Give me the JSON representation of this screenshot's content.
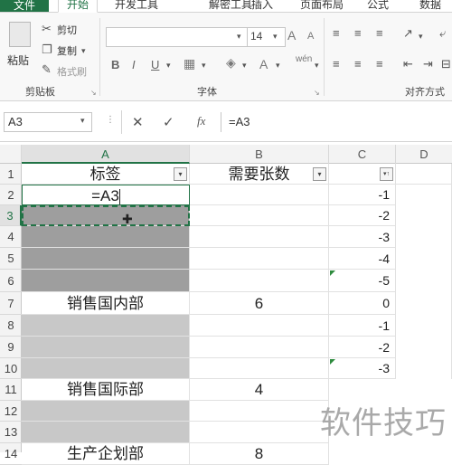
{
  "ribbon_tabs": [
    "文件",
    "开始",
    "开发工具",
    "解密工具",
    "插入",
    "页面布局",
    "公式",
    "数据"
  ],
  "clipboard": {
    "paste": "粘贴",
    "cut": "剪切",
    "copy": "复制",
    "format_painter": "格式刷",
    "group_label": "剪贴板"
  },
  "font": {
    "name": "",
    "size": "14",
    "bold": "B",
    "italic": "I",
    "underline": "U",
    "font_color_glyph": "A",
    "phonetic": "wén",
    "group_label": "字体"
  },
  "alignment": {
    "group_label": "对齐方式"
  },
  "formula_bar": {
    "name_box": "A3",
    "cancel": "✕",
    "enter": "✓",
    "fx": "fx",
    "content": "=A3"
  },
  "columns": [
    "A",
    "B",
    "C",
    "D"
  ],
  "rows": [
    "1",
    "2",
    "3",
    "4",
    "5",
    "6",
    "7",
    "8",
    "9",
    "10",
    "11",
    "12",
    "13",
    "14"
  ],
  "header_row": {
    "a": "标签",
    "b": "需要张数"
  },
  "cells": {
    "a2_formula": "=A3",
    "a7": "销售国内部",
    "b7": "6",
    "a11": "销售国际部",
    "b11": "4",
    "a14": "生产企划部",
    "b14": "8"
  },
  "column_c_values": [
    "-1",
    "-2",
    "-3",
    "-4",
    "-5",
    "0",
    "-1",
    "-2",
    "-3"
  ],
  "watermark": "软件技巧",
  "colors": {
    "accent": "#217346",
    "selected_fill": "#9e9e9e",
    "blank_fill": "#c8c8c8"
  }
}
